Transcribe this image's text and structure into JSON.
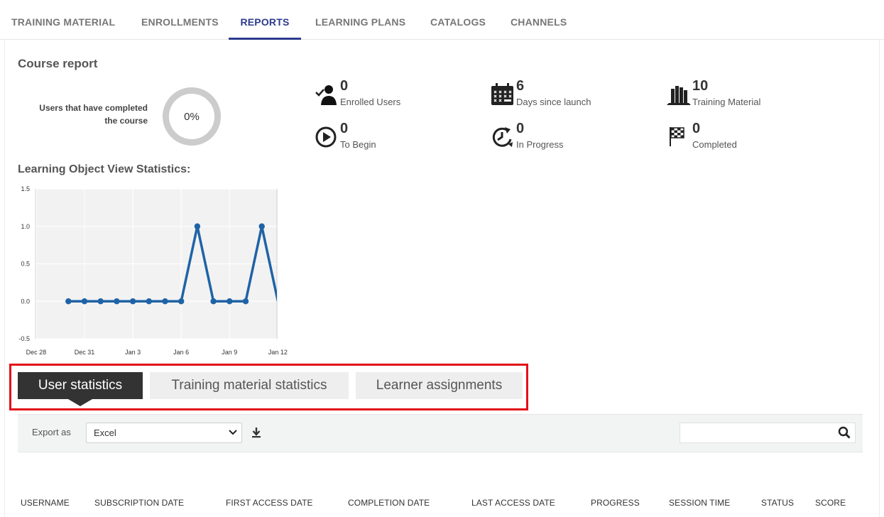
{
  "tabs": [
    {
      "label": "TRAINING MATERIAL"
    },
    {
      "label": "ENROLLMENTS"
    },
    {
      "label": "REPORTS",
      "active": true
    },
    {
      "label": "LEARNING PLANS"
    },
    {
      "label": "CATALOGS"
    },
    {
      "label": "CHANNELS"
    }
  ],
  "course_report": {
    "title": "Course report",
    "completed_label_line1": "Users that have completed",
    "completed_label_line2": "the course",
    "completed_percent": "0%"
  },
  "stats": [
    {
      "value": "0",
      "label": "Enrolled Users",
      "icon": "enrolled-users-icon"
    },
    {
      "value": "6",
      "label": "Days since launch",
      "icon": "calendar-icon"
    },
    {
      "value": "10",
      "label": "Training Material",
      "icon": "books-icon"
    },
    {
      "value": "0",
      "label": "To Begin",
      "icon": "play-circle-icon"
    },
    {
      "value": "0",
      "label": "In Progress",
      "icon": "clock-arrow-icon"
    },
    {
      "value": "0",
      "label": "Completed",
      "icon": "checkered-flag-icon"
    }
  ],
  "lo_stats_title": "Learning Object View Statistics:",
  "chart_data": {
    "type": "line",
    "x": [
      "Dec 30",
      "Dec 31",
      "Jan 1",
      "Jan 2",
      "Jan 3",
      "Jan 4",
      "Jan 5",
      "Jan 6",
      "Jan 7",
      "Jan 8",
      "Jan 9",
      "Jan 10",
      "Jan 11",
      "Jan 12"
    ],
    "series": [
      {
        "values": [
          0,
          0,
          0,
          0,
          0,
          0,
          0,
          0,
          1,
          0,
          0,
          0,
          1,
          0
        ]
      }
    ],
    "x_tick_labels": [
      "Dec 28",
      "Dec 31",
      "Jan 3",
      "Jan 6",
      "Jan 9",
      "Jan 12"
    ],
    "y_tick_labels": [
      "1.5",
      "1.0",
      "0.5",
      "0.0",
      "-0.5"
    ],
    "ylim": [
      -0.5,
      1.5
    ],
    "grid": true,
    "color": "#1f63a6"
  },
  "stat_tabs": [
    {
      "label": "User statistics",
      "active": true
    },
    {
      "label": "Training material statistics"
    },
    {
      "label": "Learner assignments"
    }
  ],
  "export": {
    "label": "Export as",
    "selected": "Excel"
  },
  "search": {
    "placeholder": ""
  },
  "table_headers": [
    "USERNAME",
    "SUBSCRIPTION DATE",
    "FIRST ACCESS DATE",
    "COMPLETION DATE",
    "LAST ACCESS DATE",
    "PROGRESS",
    "SESSION TIME",
    "STATUS",
    "SCORE"
  ],
  "colors": {
    "accent": "#2c3a8c",
    "highlight": "#e3101a",
    "line": "#1f63a6"
  }
}
